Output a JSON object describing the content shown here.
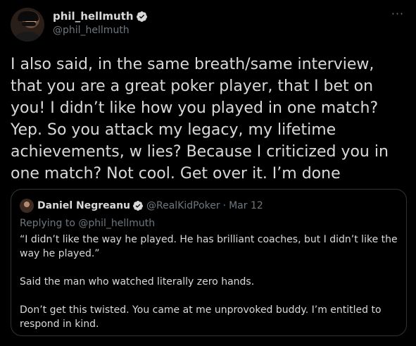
{
  "author": {
    "display_name": "phil_hellmuth",
    "handle": "@phil_hellmuth",
    "avatar_icon": "profile-photo",
    "verified_icon": "verified-badge-icon"
  },
  "more_menu": {
    "label": "···"
  },
  "tweet": {
    "text": "I also said, in the same breath/same interview, that you are a great poker player, that I bet on you! I didn’t like how you played in one match? Yep. So you attack my legacy, my lifetime achievements, w lies? Because I criticized you in one match? Not cool. Get over it. I’m done"
  },
  "quote": {
    "display_name": "Daniel Negreanu",
    "handle": "@RealKidPoker",
    "separator": "·",
    "date": "Mar 12",
    "replying_prefix": "Replying to ",
    "replying_to": "@phil_hellmuth",
    "paragraphs": [
      "“I didn’t like the way he played. He has brilliant coaches, but I didn’t like the way he played.”",
      "Said the man who watched literally zero hands.",
      "Don’t get this twisted. You came at me unprovoked buddy. I’m entitled to respond in kind."
    ]
  },
  "colors": {
    "background": "#000000",
    "text": "#d9d9d9",
    "secondary": "#6e767d",
    "border": "#2f3336",
    "verified": "#d9d9d9"
  }
}
